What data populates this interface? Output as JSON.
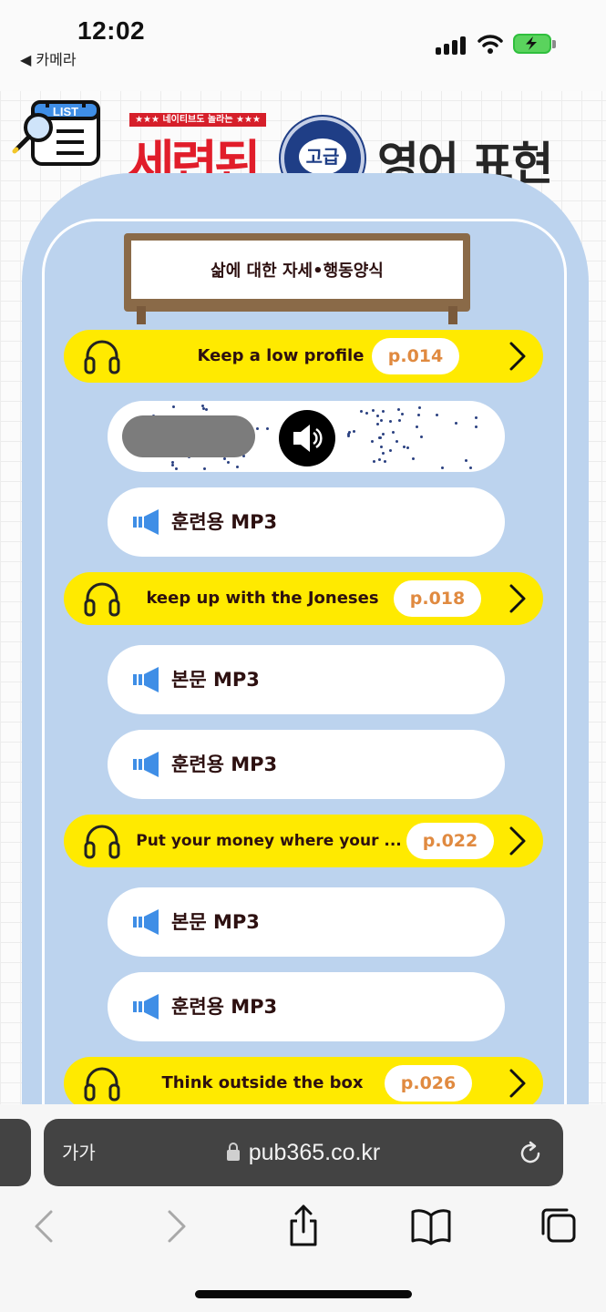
{
  "status_bar": {
    "time": "12:02",
    "back_label": "◀ 카메라"
  },
  "header": {
    "logo_label": "LIST",
    "tagline": "★★★ 네이티브도 놀라는 ★★★",
    "brand": "세련된",
    "level": "고급",
    "subtitle": "영어 표현"
  },
  "board": {
    "title": "삶에 대한 자세•행동양식"
  },
  "items": [
    {
      "title": "Keep a low profile",
      "page": "p.014"
    },
    {
      "title": "keep up with the Joneses",
      "page": "p.018"
    },
    {
      "title": "Put your money where your ...",
      "page": "p.022"
    },
    {
      "title": "Think outside the box",
      "page": "p.026"
    }
  ],
  "mp3": {
    "main_label": "본문 MP3",
    "training_label": "훈련용 MP3"
  },
  "browser": {
    "aa_label": "가가",
    "url": "pub365.co.kr"
  },
  "colors": {
    "item_bar": "#ffea00",
    "card_bg": "#bcd3ee",
    "brand_red": "#e11d2a",
    "badge_navy": "#1f3e86",
    "page_orange": "#e08a40",
    "mp3_icon_blue": "#3f8ee6"
  }
}
